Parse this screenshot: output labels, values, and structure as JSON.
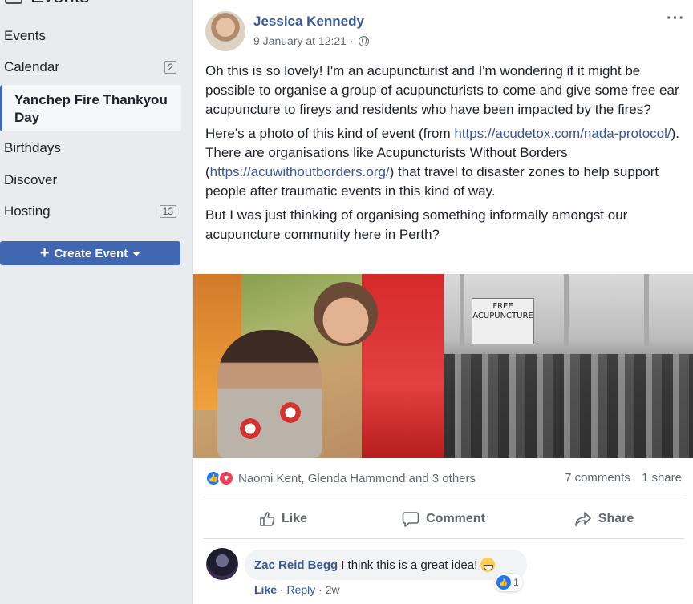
{
  "sidebar": {
    "header_title": "Events",
    "items": [
      {
        "label": "Events",
        "count": ""
      },
      {
        "label": "Calendar",
        "count": "2"
      },
      {
        "label": "Birthdays",
        "count": ""
      },
      {
        "label": "Discover",
        "count": ""
      },
      {
        "label": "Hosting",
        "count": "13"
      }
    ],
    "active_item": "Yanchep Fire Thankyou Day",
    "create_button": "Create Event"
  },
  "post": {
    "author": "Jessica Kennedy",
    "timestamp": "9 January at 12:21",
    "paragraph1": "Oh this is so lovely! I'm an acupuncturist and I'm wondering if it might be possible to organise a group of acupuncturists to come and give some free ear acupuncture to fireys and residents who have been impacted by the fires?",
    "p2_start": "Here's a photo of this kind of event (from ",
    "p2_link1": "https://acudetox.com/nada-protocol/",
    "p2_mid": "). There are organisations like Acupuncturists Without Borders (",
    "p2_link2": "https://acuwithoutborders.org/",
    "p2_end": ") that travel to disaster zones to help support people after traumatic events in this kind of way.",
    "paragraph3": "But I was just thinking of organising something informally amongst our acupuncture community here in Perth?",
    "photo_sign_text": "FREE ACUPUNCTURE",
    "reactions_names": "Naomi Kent, Glenda Hammond and 3 others",
    "comments_count": "7 comments",
    "shares_count": "1 share",
    "actions": {
      "like": "Like",
      "comment": "Comment",
      "share": "Share"
    }
  },
  "comment": {
    "author": "Zac Reid Begg",
    "text": "I think this is a great idea!",
    "reaction_count": "1",
    "like": "Like",
    "reply": "Reply",
    "age": "2w"
  },
  "colors": {
    "brand": "#4267b2",
    "link": "#385898",
    "like": "#2078f4",
    "love": "#f33e58"
  }
}
